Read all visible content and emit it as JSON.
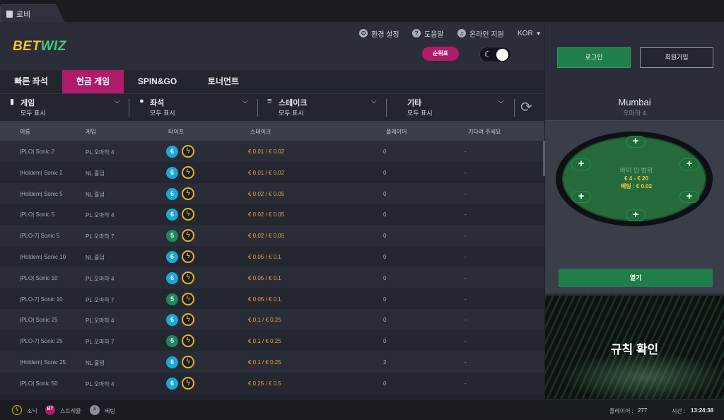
{
  "window_tab": {
    "label": "로비"
  },
  "brand": {
    "part1": "BET",
    "part2": "WIZ"
  },
  "top_links": {
    "settings": "환경 설정",
    "help": "도움말",
    "support": "온라인 지원",
    "language": "KOR"
  },
  "rank_button": "순위표",
  "auth": {
    "login": "로그인",
    "signup": "회원가입"
  },
  "game_tabs": [
    "빠른 좌석",
    "현금 게임",
    "SPIN&GO",
    "토너먼트"
  ],
  "active_tab": "현금 게임",
  "filters": [
    {
      "label": "게임",
      "value": "모두 표시",
      "icon": "cards-icon"
    },
    {
      "label": "좌석",
      "value": "모두 표시",
      "icon": "user-icon"
    },
    {
      "label": "스테이크",
      "value": "모두 표시",
      "icon": "chips-icon"
    },
    {
      "label": "기타",
      "value": "모두 표시",
      "icon": ""
    }
  ],
  "columns": [
    "이름",
    "게임",
    "타이프",
    "스테이크",
    "플레이어",
    "기다려 주세요"
  ],
  "rows": [
    {
      "name": "|PLO| Sonic 2",
      "game": "PL 오마하 4",
      "seats": "6",
      "stake": "€ 0.01 / € 0.02",
      "players": "0",
      "waiting": "-"
    },
    {
      "name": "|Holdem| Sonic 2",
      "game": "NL 홀덤",
      "seats": "6",
      "stake": "€ 0.01 / € 0.02",
      "players": "0",
      "waiting": "-"
    },
    {
      "name": "|Holdem| Sonic 5",
      "game": "NL 홀덤",
      "seats": "6",
      "stake": "€ 0.02 / € 0.05",
      "players": "0",
      "waiting": "-"
    },
    {
      "name": "|PLO| Sonic 5",
      "game": "PL 오마하 4",
      "seats": "6",
      "stake": "€ 0.02 / € 0.05",
      "players": "0",
      "waiting": "-"
    },
    {
      "name": "|PLO-7| Sonic 5",
      "game": "PL 오마하 7",
      "seats": "5",
      "stake": "€ 0.02 / € 0.05",
      "players": "0",
      "waiting": "-"
    },
    {
      "name": "|Holdem| Sonic 10",
      "game": "NL 홀덤",
      "seats": "6",
      "stake": "€ 0.05 / € 0.1",
      "players": "0",
      "waiting": "-"
    },
    {
      "name": "|PLO| Sonic 10",
      "game": "PL 오마하 4",
      "seats": "6",
      "stake": "€ 0.05 / € 0.1",
      "players": "0",
      "waiting": "-"
    },
    {
      "name": "|PLO-7| Sonic 10",
      "game": "PL 오마하 7",
      "seats": "5",
      "stake": "€ 0.05 / € 0.1",
      "players": "0",
      "waiting": "-"
    },
    {
      "name": "|PLO| Sonic 25",
      "game": "PL 오마하 4",
      "seats": "6",
      "stake": "€ 0.1 / € 0.25",
      "players": "0",
      "waiting": "-"
    },
    {
      "name": "|PLO-7| Sonic 25",
      "game": "PL 오마하 7",
      "seats": "5",
      "stake": "€ 0.1 / € 0.25",
      "players": "0",
      "waiting": "-"
    },
    {
      "name": "|Holdem| Sonic 25",
      "game": "NL 홀덤",
      "seats": "6",
      "stake": "€ 0.1 / € 0.25",
      "players": "2",
      "waiting": "-"
    },
    {
      "name": "|PLO| Sonic 50",
      "game": "PL 오마하 4",
      "seats": "6",
      "stake": "€ 0.25 / € 0.5",
      "players": "0",
      "waiting": "-"
    }
  ],
  "selected_table": {
    "name": "Mumbai",
    "game": "오마하 4",
    "buyin_label": "바이 인 범위",
    "buyin_range": "€ 4 - € 20",
    "betting": "베팅 : € 0.02",
    "open_button": "열기"
  },
  "rules_banner": "규칙 확인",
  "footer": {
    "sonic": "소닉",
    "streaming": "스트레뮬",
    "betting": "베팅",
    "players_label": "플레이어 :",
    "players_count": "277",
    "time_label": "시간 :",
    "time": "13:24:38"
  },
  "colors": {
    "accent": "#b01b6c",
    "green": "#1f7e49",
    "gold": "#f6c12e"
  }
}
